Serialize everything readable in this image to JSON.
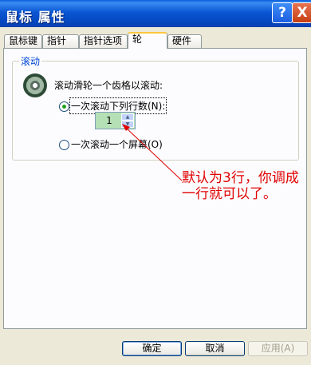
{
  "window": {
    "title": "鼠标 属性",
    "help_label": "?",
    "close_label": "X"
  },
  "tabs": [
    {
      "label": "鼠标键"
    },
    {
      "label": "指针"
    },
    {
      "label": "指针选项"
    },
    {
      "label": "轮",
      "active": true
    },
    {
      "label": "硬件"
    }
  ],
  "scroll_group": {
    "title": "滚动",
    "icon": "mouse-wheel-icon",
    "instruction": "滚动滑轮一个齿格以滚动:",
    "option_lines": {
      "label": "一次滚动下列行数(N):",
      "checked": true
    },
    "lines_value": "1",
    "option_screen": {
      "label": "一次滚动一个屏幕(O)",
      "checked": false
    }
  },
  "annotation": {
    "text": "默认为3行，你调成一行就可以了。",
    "color": "#e00000"
  },
  "buttons": {
    "ok": "确定",
    "cancel": "取消",
    "apply": "应用(A)"
  }
}
